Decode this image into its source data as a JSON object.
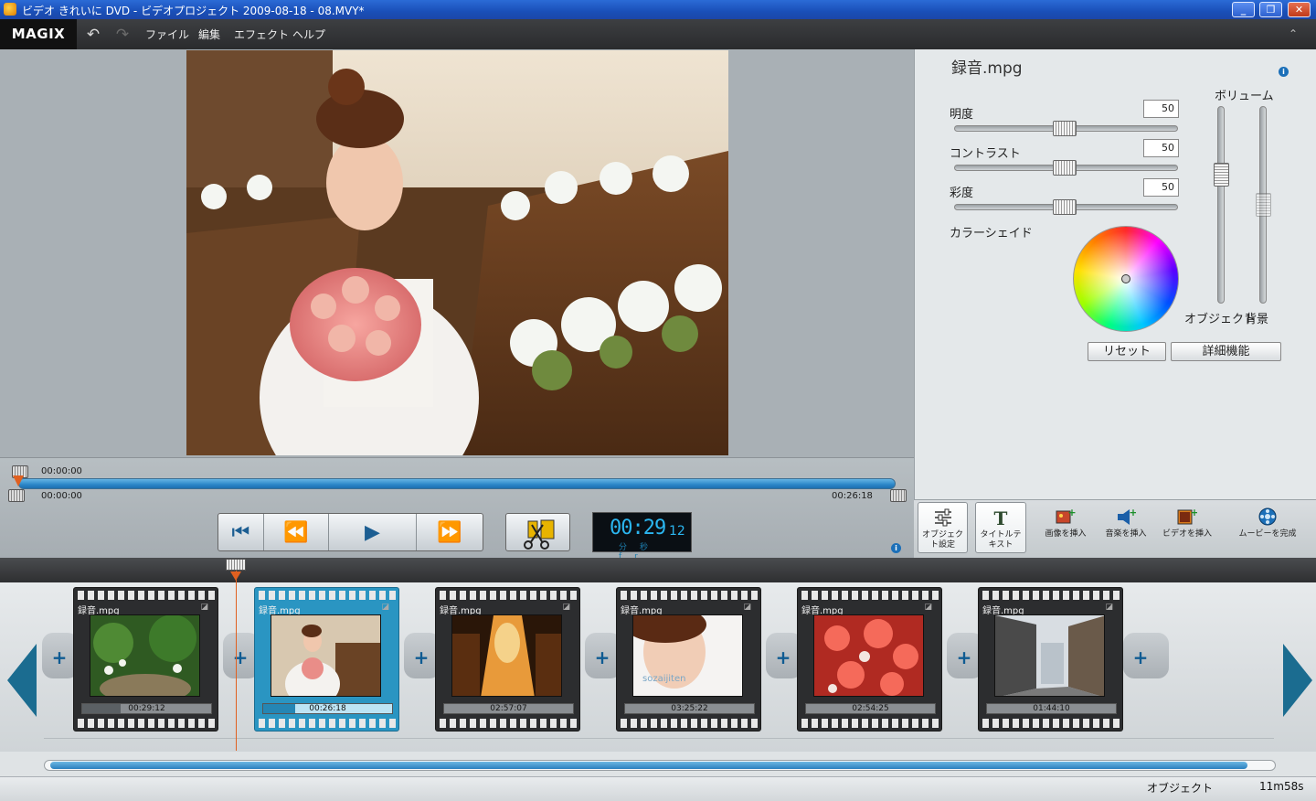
{
  "window": {
    "title": "ビデオ きれいに DVD - ビデオプロジェクト 2009-08-18 - 08.MVY*"
  },
  "menubar": {
    "logo": "MAGIX",
    "items": [
      "ファイル",
      "編集",
      "エフェクト",
      "ヘルプ"
    ],
    "collapse_glyph": "⌃"
  },
  "scrubber": {
    "top_time": "00:00:00",
    "start_time": "00:00:00",
    "end_time": "00:26:18",
    "position_fraction": 0.0
  },
  "timecode": {
    "main": "00:29",
    "frames": "12",
    "units": "分秒fr"
  },
  "panel": {
    "clip_name": "録音.mpg",
    "brightness_label": "明度",
    "brightness_value": "50",
    "contrast_label": "コントラスト",
    "contrast_value": "50",
    "saturation_label": "彩度",
    "saturation_value": "50",
    "color_shade_label": "カラーシェイド",
    "volume_label": "ボリューム",
    "object_label": "オブジェクト",
    "background_label": "背景",
    "reset_label": "リセット",
    "advanced_label": "詳細機能"
  },
  "tools": [
    {
      "label": "オブジェクト設定",
      "icon": "sliders-icon"
    },
    {
      "label": "タイトルテキスト",
      "icon": "title-T-icon"
    },
    {
      "label": "画像を挿入",
      "icon": "insert-image-icon"
    },
    {
      "label": "音楽を挿入",
      "icon": "insert-music-icon"
    },
    {
      "label": "ビデオを挿入",
      "icon": "insert-video-icon"
    },
    {
      "label": "ムービーを完成",
      "icon": "disc-icon"
    }
  ],
  "clips": [
    {
      "title": "録音.mpg",
      "duration": "00:29:12",
      "progress": 0.3
    },
    {
      "title": "録音.mpg",
      "duration": "00:26:18",
      "progress": 0.25
    },
    {
      "title": "録音.mpg",
      "duration": "02:57:07",
      "progress": 0.0
    },
    {
      "title": "録音.mpg",
      "duration": "03:25:22",
      "progress": 0.0
    },
    {
      "title": "録音.mpg",
      "duration": "02:54:25",
      "progress": 0.0
    },
    {
      "title": "録音.mpg",
      "duration": "01:44:10",
      "progress": 0.0
    }
  ],
  "status": {
    "object_label": "オブジェクト",
    "total_time": "11m58s"
  },
  "colors": {
    "accent": "#2a95c2",
    "playhead": "#e06020",
    "timecode": "#2bb6f0"
  }
}
